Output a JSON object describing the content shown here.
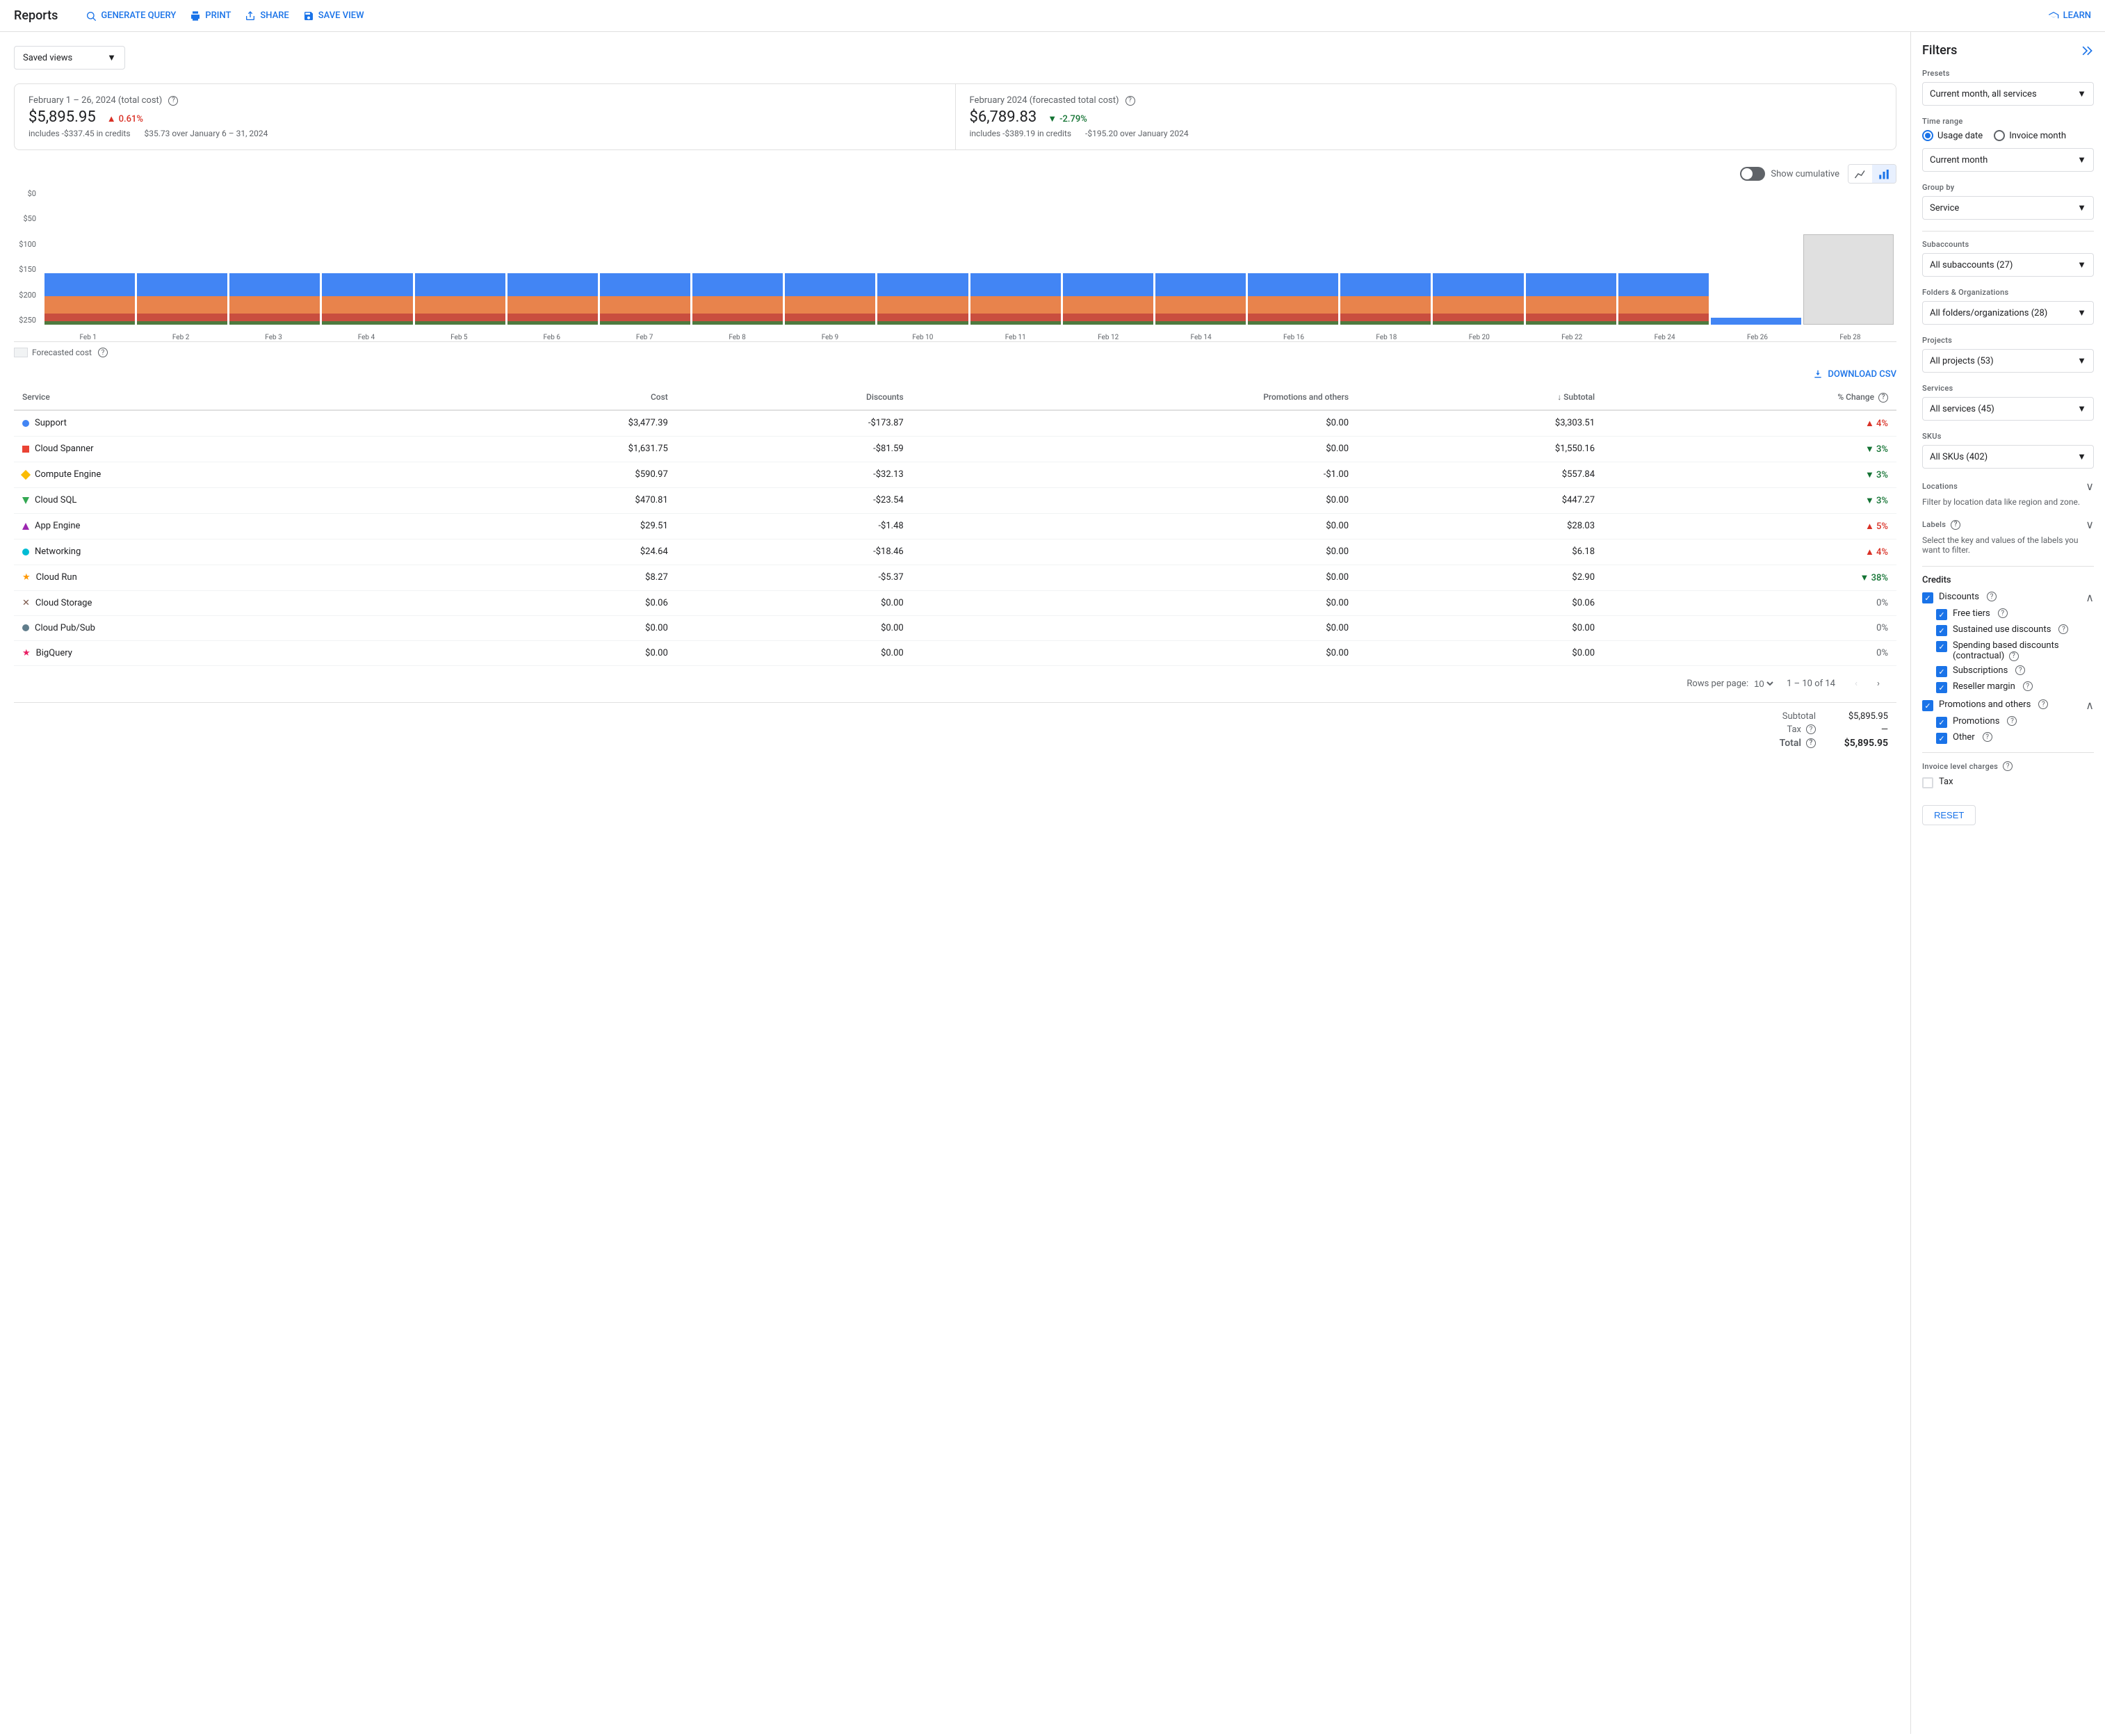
{
  "header": {
    "title": "Reports",
    "actions": [
      {
        "label": "GENERATE QUERY",
        "icon": "query-icon"
      },
      {
        "label": "PRINT",
        "icon": "print-icon"
      },
      {
        "label": "SHARE",
        "icon": "share-icon"
      },
      {
        "label": "SAVE VIEW",
        "icon": "save-icon"
      }
    ],
    "learn": "LEARN"
  },
  "savedViews": {
    "label": "Saved views"
  },
  "stats": {
    "actual": {
      "label": "February 1 – 26, 2024 (total cost)",
      "value": "$5,895.95",
      "credits": "includes -$337.45 in credits",
      "change": "0.61%",
      "change_dir": "up",
      "change_detail": "$35.73 over January 6 – 31, 2024"
    },
    "forecast": {
      "label": "February 2024 (forecasted total cost)",
      "value": "$6,789.83",
      "credits": "includes -$389.19 in credits",
      "change": "-2.79%",
      "change_dir": "down",
      "change_detail": "-$195.20 over January 2024"
    }
  },
  "chart": {
    "showCumulative": "Show cumulative",
    "forecastedLabel": "Forecasted cost",
    "yLabels": [
      "$0",
      "$50",
      "$100",
      "$150",
      "$200",
      "$250"
    ],
    "xLabels": [
      "Feb 1",
      "Feb 2",
      "Feb 3",
      "Feb 4",
      "Feb 5",
      "Feb 6",
      "Feb 7",
      "Feb 8",
      "Feb 9",
      "Feb 10",
      "Feb 11",
      "Feb 12",
      "Feb 14",
      "Feb 16",
      "Feb 18",
      "Feb 20",
      "Feb 22",
      "Feb 24",
      "Feb 26",
      "Feb 28"
    ],
    "bars": [
      {
        "blue": 55,
        "orange": 42,
        "red": 18,
        "green": 8,
        "forecast": false
      },
      {
        "blue": 55,
        "orange": 42,
        "red": 18,
        "green": 8,
        "forecast": false
      },
      {
        "blue": 55,
        "orange": 42,
        "red": 18,
        "green": 8,
        "forecast": false
      },
      {
        "blue": 55,
        "orange": 42,
        "red": 18,
        "green": 8,
        "forecast": false
      },
      {
        "blue": 55,
        "orange": 42,
        "red": 18,
        "green": 8,
        "forecast": false
      },
      {
        "blue": 55,
        "orange": 42,
        "red": 18,
        "green": 8,
        "forecast": false
      },
      {
        "blue": 55,
        "orange": 42,
        "red": 18,
        "green": 8,
        "forecast": false
      },
      {
        "blue": 55,
        "orange": 42,
        "red": 18,
        "green": 8,
        "forecast": false
      },
      {
        "blue": 55,
        "orange": 42,
        "red": 18,
        "green": 8,
        "forecast": false
      },
      {
        "blue": 55,
        "orange": 42,
        "red": 18,
        "green": 8,
        "forecast": false
      },
      {
        "blue": 55,
        "orange": 42,
        "red": 18,
        "green": 8,
        "forecast": false
      },
      {
        "blue": 55,
        "orange": 42,
        "red": 18,
        "green": 8,
        "forecast": false
      },
      {
        "blue": 55,
        "orange": 42,
        "red": 18,
        "green": 8,
        "forecast": false
      },
      {
        "blue": 55,
        "orange": 42,
        "red": 18,
        "green": 8,
        "forecast": false
      },
      {
        "blue": 55,
        "orange": 42,
        "red": 18,
        "green": 8,
        "forecast": false
      },
      {
        "blue": 55,
        "orange": 42,
        "red": 18,
        "green": 8,
        "forecast": false
      },
      {
        "blue": 55,
        "orange": 42,
        "red": 18,
        "green": 8,
        "forecast": false
      },
      {
        "blue": 55,
        "orange": 42,
        "red": 18,
        "green": 8,
        "forecast": false
      },
      {
        "blue": 12,
        "orange": 0,
        "red": 0,
        "green": 3,
        "forecast": false
      },
      {
        "blue": 0,
        "orange": 0,
        "red": 0,
        "green": 0,
        "forecast": true,
        "fHeight": 130
      }
    ]
  },
  "table": {
    "downloadLabel": "DOWNLOAD CSV",
    "columns": [
      "Service",
      "Cost",
      "Discounts",
      "Promotions and others",
      "↓ Subtotal",
      "% Change"
    ],
    "rows": [
      {
        "color": "#4285f4",
        "shape": "circle",
        "service": "Support",
        "cost": "$3,477.39",
        "discounts": "-$173.87",
        "promo": "$0.00",
        "subtotal": "$3,303.51",
        "pct": "4%",
        "dir": "up"
      },
      {
        "color": "#ea4335",
        "shape": "square",
        "service": "Cloud Spanner",
        "cost": "$1,631.75",
        "discounts": "-$81.59",
        "promo": "$0.00",
        "subtotal": "$1,550.16",
        "pct": "3%",
        "dir": "down"
      },
      {
        "color": "#fbbc04",
        "shape": "diamond",
        "service": "Compute Engine",
        "cost": "$590.97",
        "discounts": "-$32.13",
        "promo": "-$1.00",
        "subtotal": "$557.84",
        "pct": "3%",
        "dir": "down"
      },
      {
        "color": "#34a853",
        "shape": "triangle",
        "service": "Cloud SQL",
        "cost": "$470.81",
        "discounts": "-$23.54",
        "promo": "$0.00",
        "subtotal": "$447.27",
        "pct": "3%",
        "dir": "down"
      },
      {
        "color": "#9c27b0",
        "shape": "triangle-up",
        "service": "App Engine",
        "cost": "$29.51",
        "discounts": "-$1.48",
        "promo": "$0.00",
        "subtotal": "$28.03",
        "pct": "5%",
        "dir": "up"
      },
      {
        "color": "#00bcd4",
        "shape": "circle",
        "service": "Networking",
        "cost": "$24.64",
        "discounts": "-$18.46",
        "promo": "$0.00",
        "subtotal": "$6.18",
        "pct": "4%",
        "dir": "up"
      },
      {
        "color": "#ff9800",
        "shape": "star",
        "service": "Cloud Run",
        "cost": "$8.27",
        "discounts": "-$5.37",
        "promo": "$0.00",
        "subtotal": "$2.90",
        "pct": "38%",
        "dir": "down"
      },
      {
        "color": "#795548",
        "shape": "x",
        "service": "Cloud Storage",
        "cost": "$0.06",
        "discounts": "$0.00",
        "promo": "$0.00",
        "subtotal": "$0.06",
        "pct": "0%",
        "dir": "zero"
      },
      {
        "color": "#607d8b",
        "shape": "circle",
        "service": "Cloud Pub/Sub",
        "cost": "$0.00",
        "discounts": "$0.00",
        "promo": "$0.00",
        "subtotal": "$0.00",
        "pct": "0%",
        "dir": "zero"
      },
      {
        "color": "#e91e63",
        "shape": "star",
        "service": "BigQuery",
        "cost": "$0.00",
        "discounts": "$0.00",
        "promo": "$0.00",
        "subtotal": "$0.00",
        "pct": "0%",
        "dir": "zero"
      }
    ],
    "pagination": {
      "rowsPerPage": "10",
      "range": "1 – 10 of 14"
    },
    "totals": {
      "subtotalLabel": "Subtotal",
      "subtotalValue": "$5,895.95",
      "taxLabel": "Tax",
      "taxValue": "—",
      "totalLabel": "Total",
      "totalValue": "$5,895.95"
    }
  },
  "filters": {
    "title": "Filters",
    "presets": {
      "label": "Presets",
      "value": "Current month, all services"
    },
    "timeRange": {
      "label": "Time range",
      "usageDate": "Usage date",
      "invoiceMonth": "Invoice month",
      "currentMonth": "Current month"
    },
    "groupBy": {
      "label": "Group by",
      "value": "Service"
    },
    "subaccounts": {
      "label": "Subaccounts",
      "value": "All subaccounts (27)"
    },
    "folders": {
      "label": "Folders & Organizations",
      "value": "All folders/organizations (28)"
    },
    "projects": {
      "label": "Projects",
      "value": "All projects (53)"
    },
    "services": {
      "label": "Services",
      "value": "All services (45)"
    },
    "skus": {
      "label": "SKUs",
      "value": "All SKUs (402)"
    },
    "locations": {
      "label": "Locations",
      "sublabel": "Filter by location data like region and zone."
    },
    "labels": {
      "label": "Labels",
      "sublabel": "Select the key and values of the labels you want to filter."
    },
    "credits": {
      "label": "Credits",
      "discounts": "Discounts",
      "freeTiers": "Free tiers",
      "sustainedUse": "Sustained use discounts",
      "spendingBased": "Spending based discounts (contractual)",
      "subscriptions": "Subscriptions",
      "resellerMargin": "Reseller margin",
      "promotionsAndOthers": "Promotions and others",
      "promotions": "Promotions",
      "other": "Other"
    },
    "invoiceCharges": {
      "label": "Invoice level charges",
      "tax": "Tax"
    },
    "resetLabel": "RESET"
  }
}
